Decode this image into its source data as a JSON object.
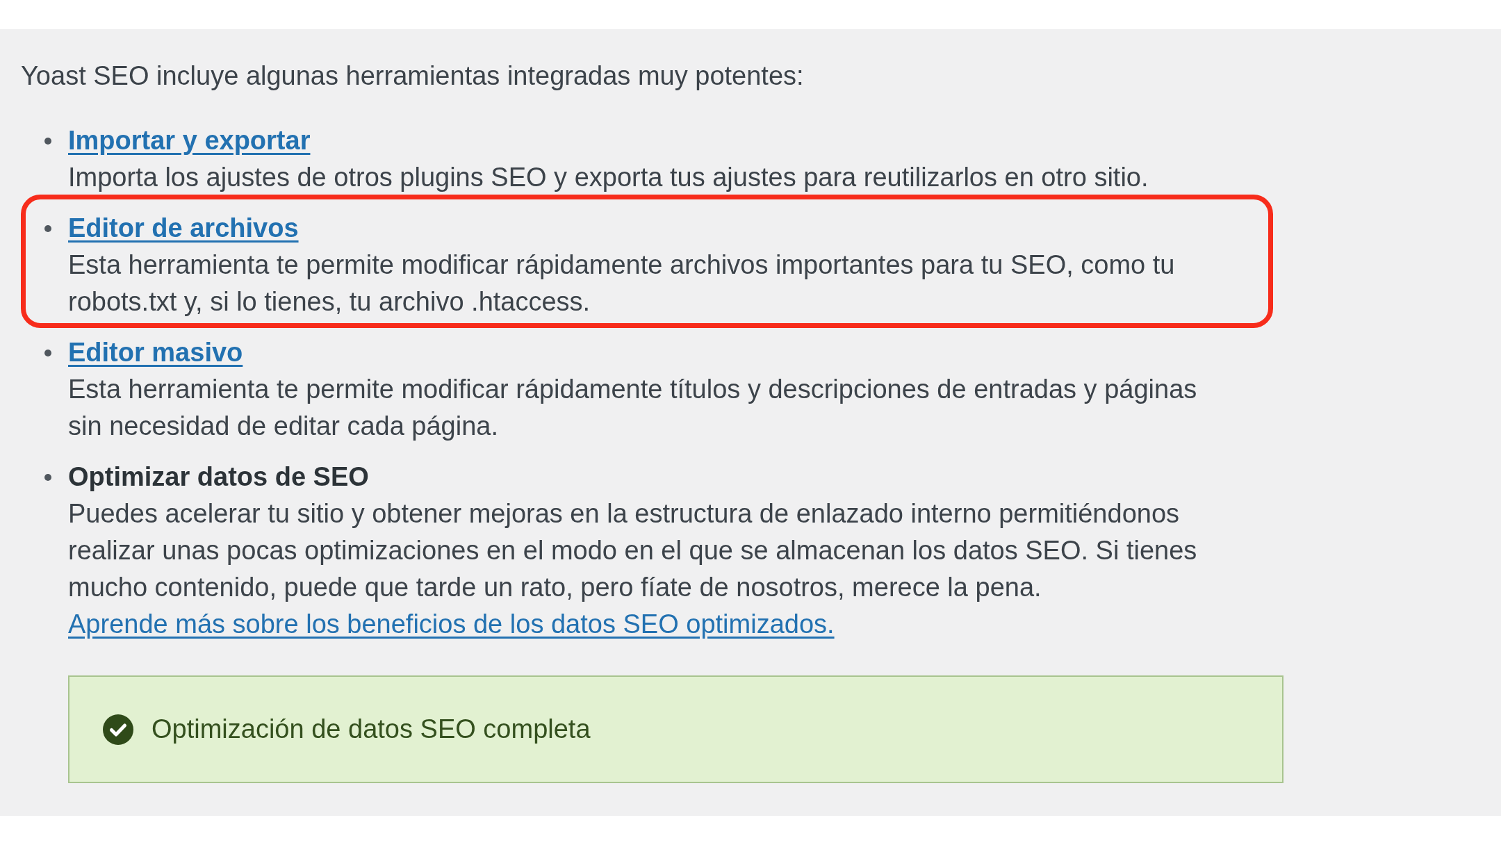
{
  "intro": "Yoast SEO incluye algunas herramientas integradas muy potentes:",
  "tools": [
    {
      "kind": "link",
      "title": "Importar y exportar",
      "description": "Importa los ajustes de otros plugins SEO y exporta tus ajustes para reutilizarlos en otro sitio.",
      "highlighted": false
    },
    {
      "kind": "link",
      "title": "Editor de archivos",
      "description": "Esta herramienta te permite modificar rápidamente archivos importantes para tu SEO, como tu robots.txt y, si lo tienes, tu archivo .htaccess.",
      "highlighted": true
    },
    {
      "kind": "link",
      "title": "Editor masivo",
      "description": "Esta herramienta te permite modificar rápidamente títulos y descripciones de entradas y páginas sin necesidad de editar cada página.",
      "highlighted": false
    },
    {
      "kind": "text",
      "title": "Optimizar datos de SEO",
      "description": "Puedes acelerar tu sitio y obtener mejoras en la estructura de enlazado interno permitiéndonos realizar unas pocas optimizaciones en el modo en el que se almacenan los datos SEO. Si tienes mucho contenido, puede que tarde un rato, pero fíate de nosotros, merece la pena.",
      "link": "Aprende más sobre los beneficios de los datos SEO optimizados.",
      "highlighted": false
    }
  ],
  "notice": {
    "message": "Optimización de datos SEO completa"
  }
}
